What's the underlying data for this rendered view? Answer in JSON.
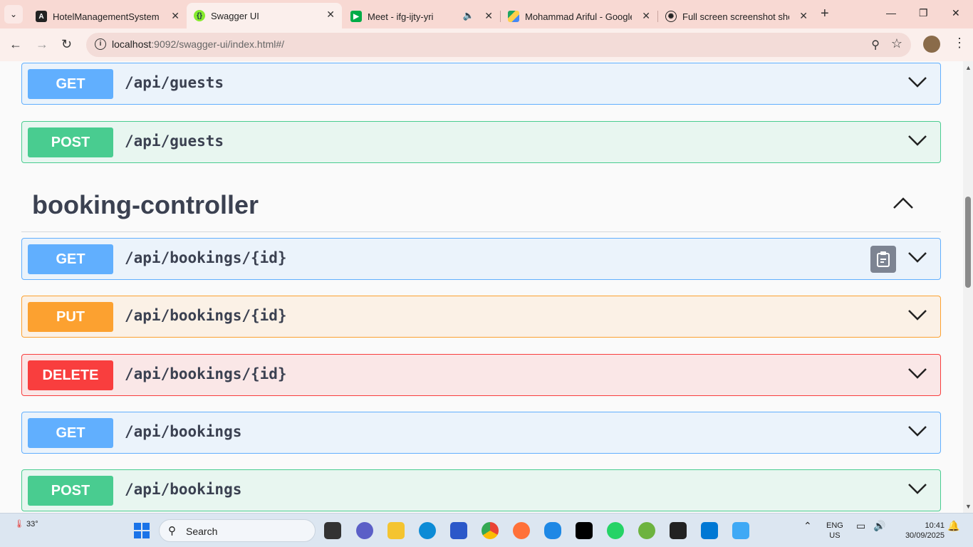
{
  "browser": {
    "tabs": [
      {
        "title": "HotelManagementSystem",
        "icon": "angular-icon"
      },
      {
        "title": "Swagger UI",
        "icon": "swagger-icon",
        "active": true
      },
      {
        "title": "Meet - ifg-ijty-yri",
        "icon": "meet-icon",
        "audio": true
      },
      {
        "title": "Mohammad Ariful - Google",
        "icon": "drive-icon"
      },
      {
        "title": "Full screen screenshot shortc",
        "icon": "openai-icon"
      }
    ],
    "url_host": "localhost",
    "url_rest": ":9092/swagger-ui/index.html#/"
  },
  "swagger": {
    "top_ops": [
      {
        "method": "GET",
        "path": "/api/guests"
      },
      {
        "method": "POST",
        "path": "/api/guests"
      }
    ],
    "tag": "booking-controller",
    "tag_ops": [
      {
        "method": "GET",
        "path": "/api/bookings/{id}"
      },
      {
        "method": "PUT",
        "path": "/api/bookings/{id}"
      },
      {
        "method": "DELETE",
        "path": "/api/bookings/{id}"
      },
      {
        "method": "GET",
        "path": "/api/bookings"
      },
      {
        "method": "POST",
        "path": "/api/bookings"
      }
    ]
  },
  "taskbar": {
    "weather_temp": "33°",
    "search_label": "Search",
    "lang_line1": "ENG",
    "lang_line2": "US",
    "time": "10:41",
    "date": "30/09/2025"
  },
  "colors": {
    "get": "#61affe",
    "post": "#49cc90",
    "put": "#fca130",
    "delete": "#f93e3e"
  }
}
